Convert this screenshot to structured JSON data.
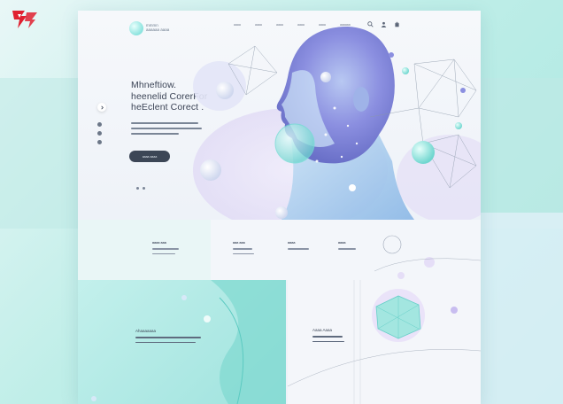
{
  "brand": {
    "name_line1": "mmmn",
    "name_line2": "aaaaaa aaaa"
  },
  "nav": {
    "items": [
      "aaaa",
      "aaaa",
      "aaaa",
      "aaaa",
      "aaaa",
      "aaaaaa"
    ]
  },
  "hero": {
    "headline_line1": "Mhneftiow.",
    "headline_line2": "heenelid CorerFor",
    "headline_line3": "heEclent Corect .",
    "cta_label": "aaaa aaaa"
  },
  "section2": {
    "columns": [
      {
        "title": "aaaa aaa"
      },
      {
        "title": "aaa aaa"
      },
      {
        "title": "aaaa"
      },
      {
        "title": "aaaa"
      }
    ]
  },
  "section3": {
    "left_title": "Ahaaaaaaa",
    "right_title": "Aaaa Aaaa"
  },
  "colors": {
    "accent": "#8be3de",
    "dark": "#3c4656",
    "bg": "#bfeee8"
  },
  "icons": [
    "search-icon",
    "user-icon",
    "bag-icon",
    "chevron-right-icon",
    "logo-icon"
  ]
}
